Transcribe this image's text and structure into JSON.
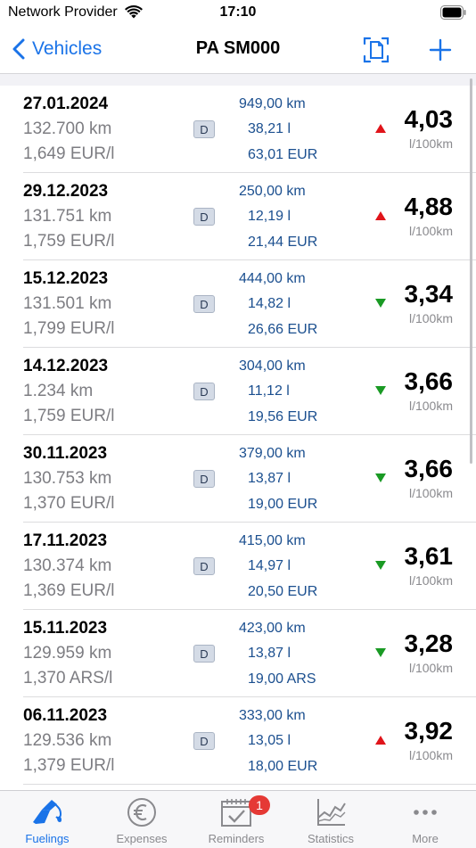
{
  "status_bar": {
    "carrier": "Network Provider",
    "time": "17:10"
  },
  "nav": {
    "back_label": "Vehicles",
    "title": "PA SM000"
  },
  "colors": {
    "accent": "#1a73e8",
    "trend_up": "#e0141a",
    "trend_down": "#1a9a24",
    "value_blue": "#1b4f8f"
  },
  "fuelings": [
    {
      "date": "27.01.2024",
      "odometer": "132.700 km",
      "price_per_unit": "1,649 EUR/l",
      "fuel_type": "D",
      "distance": "949,00 km",
      "volume": "38,21 l",
      "cost": "63,01 EUR",
      "trend": "up",
      "consumption": "4,03",
      "unit": "l/100km"
    },
    {
      "date": "29.12.2023",
      "odometer": "131.751 km",
      "price_per_unit": "1,759 EUR/l",
      "fuel_type": "D",
      "distance": "250,00 km",
      "volume": "12,19 l",
      "cost": "21,44 EUR",
      "trend": "up",
      "consumption": "4,88",
      "unit": "l/100km"
    },
    {
      "date": "15.12.2023",
      "odometer": "131.501 km",
      "price_per_unit": "1,799 EUR/l",
      "fuel_type": "D",
      "distance": "444,00 km",
      "volume": "14,82 l",
      "cost": "26,66 EUR",
      "trend": "down",
      "consumption": "3,34",
      "unit": "l/100km"
    },
    {
      "date": "14.12.2023",
      "odometer": "1.234 km",
      "price_per_unit": "1,759 EUR/l",
      "fuel_type": "D",
      "distance": "304,00 km",
      "volume": "11,12 l",
      "cost": "19,56 EUR",
      "trend": "down",
      "consumption": "3,66",
      "unit": "l/100km"
    },
    {
      "date": "30.11.2023",
      "odometer": "130.753 km",
      "price_per_unit": "1,370 EUR/l",
      "fuel_type": "D",
      "distance": "379,00 km",
      "volume": "13,87 l",
      "cost": "19,00 EUR",
      "trend": "down",
      "consumption": "3,66",
      "unit": "l/100km"
    },
    {
      "date": "17.11.2023",
      "odometer": "130.374 km",
      "price_per_unit": "1,369 EUR/l",
      "fuel_type": "D",
      "distance": "415,00 km",
      "volume": "14,97 l",
      "cost": "20,50 EUR",
      "trend": "down",
      "consumption": "3,61",
      "unit": "l/100km"
    },
    {
      "date": "15.11.2023",
      "odometer": "129.959 km",
      "price_per_unit": "1,370 ARS/l",
      "fuel_type": "D",
      "distance": "423,00 km",
      "volume": "13,87 l",
      "cost": "19,00 ARS",
      "trend": "down",
      "consumption": "3,28",
      "unit": "l/100km"
    },
    {
      "date": "06.11.2023",
      "odometer": "129.536 km",
      "price_per_unit": "1,379 EUR/l",
      "fuel_type": "D",
      "distance": "333,00 km",
      "volume": "13,05 l",
      "cost": "18,00 EUR",
      "trend": "up",
      "consumption": "3,92",
      "unit": "l/100km"
    }
  ],
  "tabs": [
    {
      "label": "Fuelings",
      "icon": "fuel-nozzle-icon",
      "active": true
    },
    {
      "label": "Expenses",
      "icon": "euro-icon",
      "active": false
    },
    {
      "label": "Reminders",
      "icon": "calendar-check-icon",
      "active": false,
      "badge": "1"
    },
    {
      "label": "Statistics",
      "icon": "chart-icon",
      "active": false
    },
    {
      "label": "More",
      "icon": "more-dots-icon",
      "active": false
    }
  ]
}
